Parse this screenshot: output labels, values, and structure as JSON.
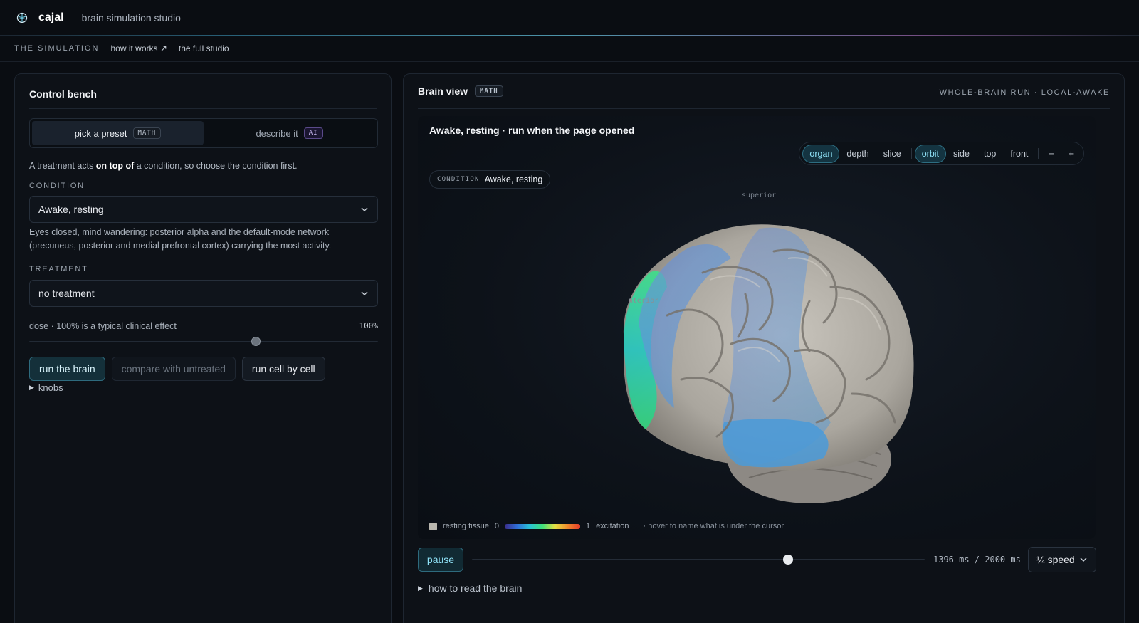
{
  "app": {
    "name": "cajal",
    "subtitle": "brain simulation studio",
    "icon": "brain-logo-icon"
  },
  "subnav": {
    "current": "THE SIMULATION",
    "links": [
      "how it works ↗",
      "the full studio"
    ]
  },
  "control_bench": {
    "title": "Control bench",
    "tabs": [
      {
        "label": "pick a preset",
        "badge": "MATH",
        "active": true
      },
      {
        "label": "describe it",
        "badge": "AI",
        "active": false
      }
    ],
    "hint_before": "A treatment acts ",
    "hint_bold": "on top of",
    "hint_after": " a condition, so choose the condition first.",
    "condition": {
      "label": "CONDITION",
      "value": "Awake, resting",
      "description": "Eyes closed, mind wandering: posterior alpha and the default-mode network (precuneus, posterior and medial prefrontal cortex) carrying the most activity."
    },
    "treatment": {
      "label": "TREATMENT",
      "value": "no treatment"
    },
    "dose": {
      "label": "dose · 100% is a typical clinical effect",
      "value_text": "100%",
      "value": 1.0,
      "enabled": false
    },
    "buttons": {
      "run": "run the brain",
      "compare": "compare with untreated",
      "cell": "run cell by cell"
    },
    "knobs": "knobs"
  },
  "brain_view": {
    "title": "Brain view",
    "badge": "MATH",
    "run_label": "WHOLE-BRAIN RUN · LOCAL-AWAKE",
    "viewport_title": "Awake, resting · run when the page opened",
    "render_modes": [
      {
        "label": "organ",
        "active": true
      },
      {
        "label": "depth",
        "active": false
      },
      {
        "label": "slice",
        "active": false
      }
    ],
    "camera_modes": [
      {
        "label": "orbit",
        "active": true
      },
      {
        "label": "side",
        "active": false
      },
      {
        "label": "top",
        "active": false
      },
      {
        "label": "front",
        "active": false
      }
    ],
    "zoom": {
      "out": "−",
      "in": "+"
    },
    "condition_pill": {
      "key": "CONDITION",
      "value": "Awake, resting"
    },
    "axis_labels": {
      "superior": "superior",
      "anterior": "nterior"
    },
    "legend": {
      "resting": "resting tissue",
      "min": "0",
      "max": "1",
      "scale_label": "excitation",
      "note": "· hover to name what is under the cursor"
    },
    "playback": {
      "pause": "pause",
      "current_ms": 1396,
      "total_ms": 2000,
      "readout": "1396 ms / 2000 ms",
      "speed": "¼ speed"
    },
    "howto": "how to read the brain"
  },
  "colors": {
    "accent": "#8fe2f7",
    "background": "#0a0d12",
    "panel": "#0d1117",
    "tissue": "#b9b6ae"
  }
}
